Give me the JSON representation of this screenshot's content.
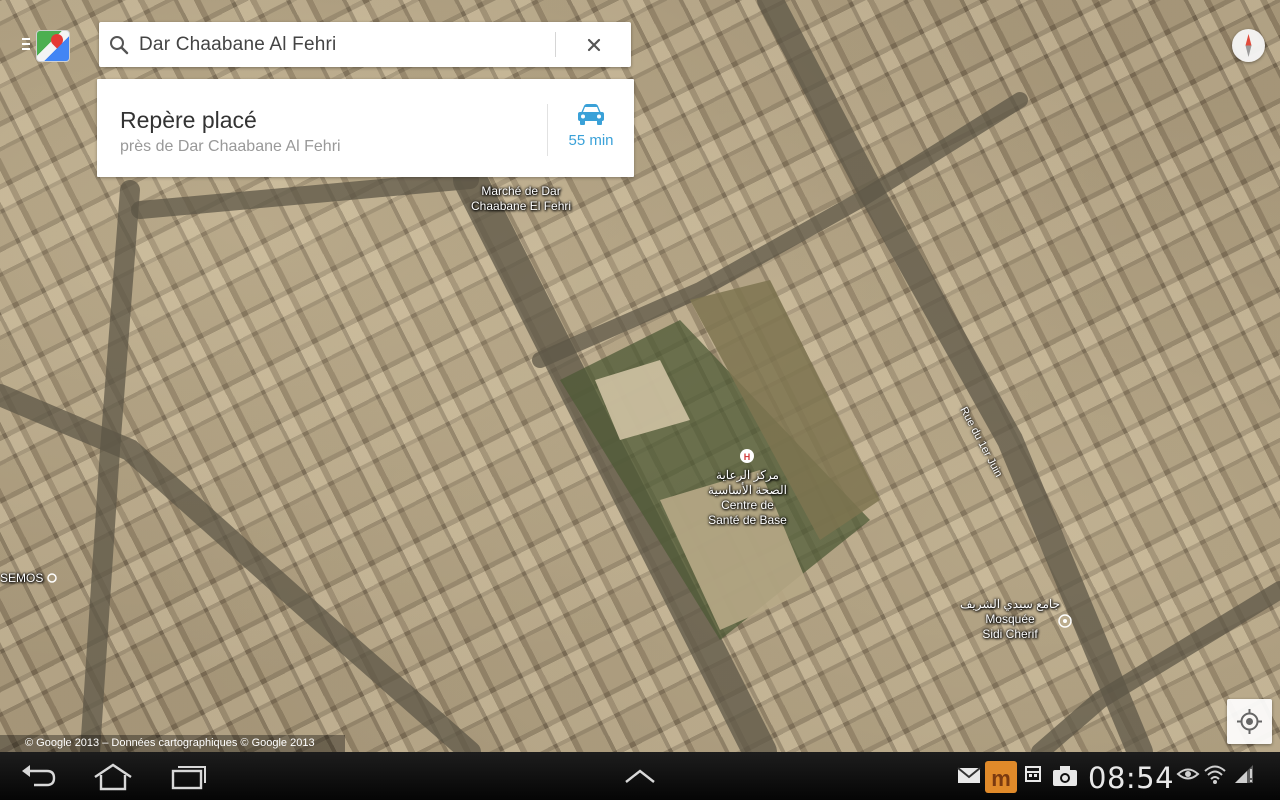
{
  "search": {
    "query": "Dar Chaabane Al Fehri"
  },
  "info_card": {
    "title": "Repère placé",
    "subtitle": "près de Dar Chaabane Al Fehri",
    "drive_time": "55 min"
  },
  "map": {
    "labels": {
      "market": "Marché de Dar\nChaabane El Fehri",
      "health_ar_1": "مركز الرعاية",
      "health_ar_2": "الصحة الأساسية",
      "health_fr_1": "Centre de",
      "health_fr_2": "Santé de Base",
      "mosque_ar": "جامع سيدي الشريف",
      "mosque_fr_1": "Mosquée",
      "mosque_fr_2": "Sidi Cherif",
      "semos": "SEMOS",
      "rue_1er_juin": "Rue du 1er Juin"
    },
    "attribution": "© Google 2013 – Données cartographiques © Google 2013"
  },
  "status_bar": {
    "time": "08:54"
  },
  "colors": {
    "accent_blue": "#3aa1d8",
    "card_bg": "#ffffff",
    "nav_bg": "#000000"
  },
  "icons": [
    "menu-icon",
    "maps-logo-icon",
    "search-icon",
    "close-icon",
    "car-icon",
    "compass-icon",
    "my-location-icon",
    "back-icon",
    "home-icon",
    "recent-apps-icon",
    "up-arrow-icon",
    "gmail-icon",
    "notification-app-icon",
    "calendar-icon",
    "camera-icon",
    "eye-icon",
    "wifi-icon",
    "signal-icon"
  ]
}
